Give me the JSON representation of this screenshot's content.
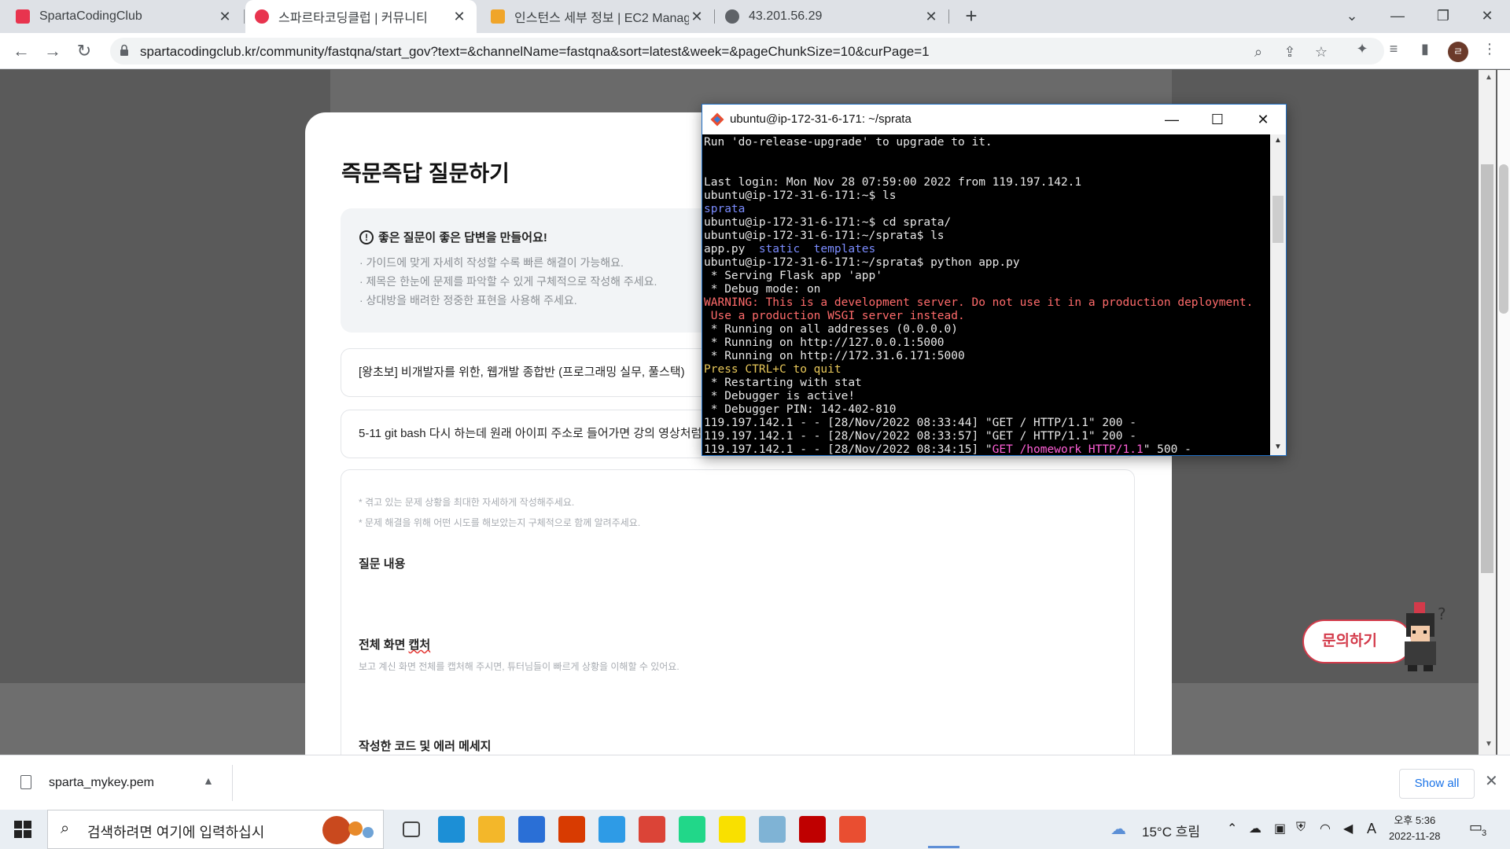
{
  "browser": {
    "tabs": [
      {
        "title": "SpartaCodingClub",
        "active": false,
        "favicon_color": "#e8344e"
      },
      {
        "title": "스파르타코딩클럽 | 커뮤니티",
        "active": true,
        "favicon_color": "#e8344e"
      },
      {
        "title": "인스턴스 세부 정보 | EC2 Manag",
        "active": false,
        "favicon_color": "#f0a52a"
      },
      {
        "title": "43.201.56.29",
        "active": false,
        "favicon_color": "#5f6368"
      }
    ],
    "url": "spartacodingclub.kr/community/fastqna/start_gov?text=&channelName=fastqna&sort=latest&week=&pageChunkSize=10&curPage=1",
    "profile_initial": "ㄹ"
  },
  "page": {
    "modal_title": "즉문즉답 질문하기",
    "guide": {
      "heading": "좋은 질문이 좋은 답변을 만들어요!",
      "lines": [
        "· 가이드에 맞게 자세히 작성할 수록 빠른 해결이 가능해요.",
        "· 제목은 한눈에 문제를 파악할 수 있게 구체적으로 작성해 주세요.",
        "· 상대방을 배려한 정중한 표현을 사용해 주세요."
      ]
    },
    "course_field": "[왕초보] 비개발자를 위한, 웹개발 종합반 (프로그래밍 실무, 풀스택)",
    "title_field": "5-11 git bash 다시 하는데 원래 아이피 주소로 들어가면 강의 영상처럼",
    "editor": {
      "hint1": "* 겪고 있는 문제 상황을 최대한 자세하게 작성해주세요.",
      "hint2": "* 문제 해결을 위해 어떤 시도를 해보았는지 구체적으로 함께 알려주세요.",
      "section1": "질문 내용",
      "section2": "전체 화면 캡처",
      "section2_sub": "보고 계신 화면 전체를 캡처해 주시면, 튜터님들이 빠르게 상황을 이해할 수 있어요.",
      "section3": "작성한 코드 및 에러 메세지"
    },
    "help_button": "문의하기"
  },
  "terminal": {
    "title": "ubuntu@ip-172-31-6-171: ~/sprata",
    "lines": [
      {
        "segments": [
          {
            "t": "Run 'do-release-upgrade' to upgrade to it.",
            "c": ""
          }
        ]
      },
      {
        "segments": [
          {
            "t": "",
            "c": ""
          }
        ]
      },
      {
        "segments": [
          {
            "t": "",
            "c": ""
          }
        ]
      },
      {
        "segments": [
          {
            "t": "Last login: Mon Nov 28 07:59:00 2022 from 119.197.142.1",
            "c": ""
          }
        ]
      },
      {
        "segments": [
          {
            "t": "ubuntu@ip-172-31-6-171:~$ ls",
            "c": ""
          }
        ]
      },
      {
        "segments": [
          {
            "t": "sprata",
            "c": "c-blue"
          }
        ]
      },
      {
        "segments": [
          {
            "t": "ubuntu@ip-172-31-6-171:~$ cd sprata/",
            "c": ""
          }
        ]
      },
      {
        "segments": [
          {
            "t": "ubuntu@ip-172-31-6-171:~/sprata$ ls",
            "c": ""
          }
        ]
      },
      {
        "segments": [
          {
            "t": "app.py  ",
            "c": ""
          },
          {
            "t": "static  templates",
            "c": "c-blue"
          }
        ]
      },
      {
        "segments": [
          {
            "t": "ubuntu@ip-172-31-6-171:~/sprata$ python app.py",
            "c": ""
          }
        ]
      },
      {
        "segments": [
          {
            "t": " * Serving Flask app 'app'",
            "c": ""
          }
        ]
      },
      {
        "segments": [
          {
            "t": " * Debug mode: on",
            "c": ""
          }
        ]
      },
      {
        "segments": [
          {
            "t": "WARNING: This is a development server. Do not use it in a production deployment.",
            "c": "c-red"
          }
        ]
      },
      {
        "segments": [
          {
            "t": " Use a production WSGI server instead.",
            "c": "c-red"
          }
        ]
      },
      {
        "segments": [
          {
            "t": " * Running on all addresses (0.0.0.0)",
            "c": ""
          }
        ]
      },
      {
        "segments": [
          {
            "t": " * Running on http://127.0.0.1:5000",
            "c": ""
          }
        ]
      },
      {
        "segments": [
          {
            "t": " * Running on http://172.31.6.171:5000",
            "c": ""
          }
        ]
      },
      {
        "segments": [
          {
            "t": "Press CTRL+C to quit",
            "c": "c-yellow"
          }
        ]
      },
      {
        "segments": [
          {
            "t": " * Restarting with stat",
            "c": ""
          }
        ]
      },
      {
        "segments": [
          {
            "t": " * Debugger is active!",
            "c": ""
          }
        ]
      },
      {
        "segments": [
          {
            "t": " * Debugger PIN: 142-402-810",
            "c": ""
          }
        ]
      },
      {
        "segments": [
          {
            "t": "119.197.142.1 - - [28/Nov/2022 08:33:44] \"GET / HTTP/1.1\" 200 -",
            "c": ""
          }
        ]
      },
      {
        "segments": [
          {
            "t": "119.197.142.1 - - [28/Nov/2022 08:33:57] \"GET / HTTP/1.1\" 200 -",
            "c": ""
          }
        ]
      },
      {
        "segments": [
          {
            "t": "119.197.142.1 - - [28/Nov/2022 08:34:15] \"",
            "c": ""
          },
          {
            "t": "GET /homework HTTP/1.1",
            "c": "c-pink"
          },
          {
            "t": "\" 500 -",
            "c": ""
          }
        ]
      }
    ]
  },
  "downloads": {
    "file": "sparta_mykey.pem",
    "show_all": "Show all"
  },
  "taskbar": {
    "search_placeholder": "검색하려면 여기에 입력하십시",
    "weather": "15°C  흐림",
    "ime": "A",
    "time": "오후 5:36",
    "date": "2022-11-28",
    "notification_count": "3",
    "apps": [
      {
        "icon": "task-view-icon",
        "color": "#444444"
      },
      {
        "icon": "edge-icon",
        "color": "#1c8fd6"
      },
      {
        "icon": "file-explorer-icon",
        "color": "#f3b72a"
      },
      {
        "icon": "store-icon",
        "color": "#2a6fd6"
      },
      {
        "icon": "office-icon",
        "color": "#d83b01"
      },
      {
        "icon": "internet-explorer-icon",
        "color": "#2e9be6"
      },
      {
        "icon": "chrome-icon",
        "color": "#db4437"
      },
      {
        "icon": "pycharm-icon",
        "color": "#21d789"
      },
      {
        "icon": "kakaotalk-icon",
        "color": "#f9e000"
      },
      {
        "icon": "app-window-icon",
        "color": "#7fb3d5"
      },
      {
        "icon": "filezilla-icon",
        "color": "#bf0000"
      },
      {
        "icon": "git-bash-icon",
        "color": "#e94e31"
      }
    ]
  }
}
